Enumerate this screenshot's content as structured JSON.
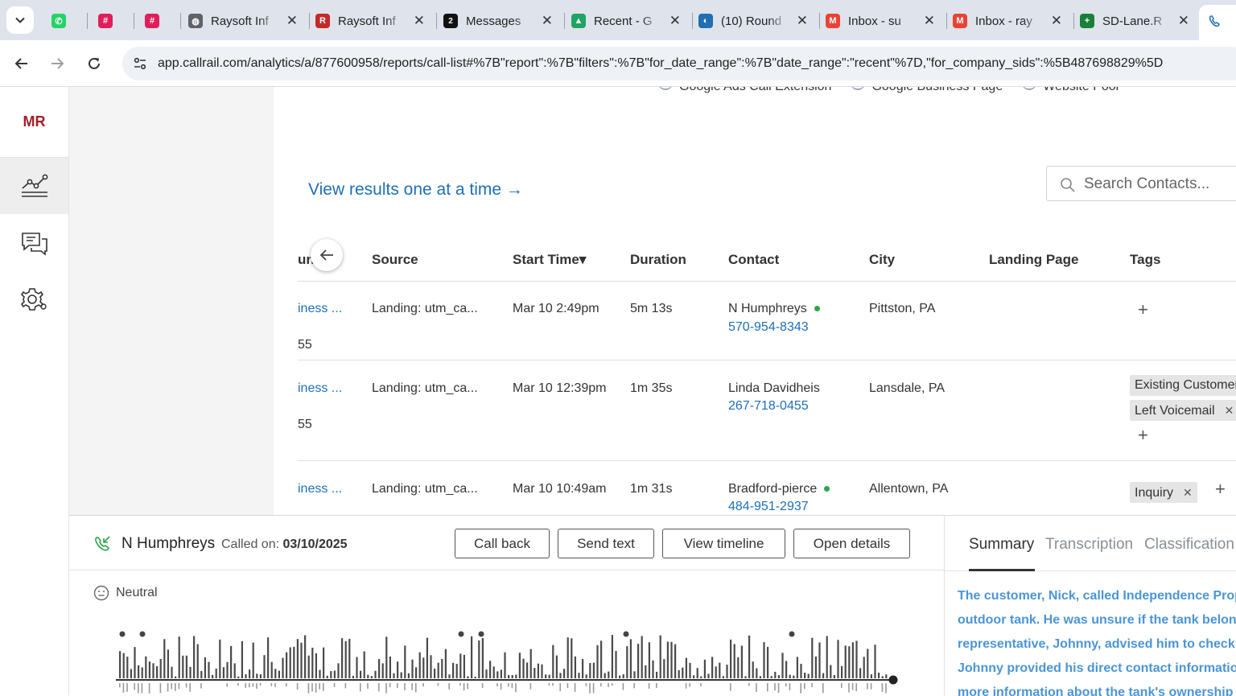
{
  "browser": {
    "tabs": [
      {
        "title": "",
        "icon": "whatsapp-icon",
        "color": "#25d366"
      },
      {
        "title": "",
        "icon": "slack-icon",
        "color": "#e01e5a"
      },
      {
        "title": "",
        "icon": "slack-icon",
        "color": "#e01e5a"
      },
      {
        "title": "Raysoft Inf",
        "icon": "globe-icon",
        "color": "#5f6368"
      },
      {
        "title": "Raysoft Inf",
        "icon": "raysoft-icon",
        "color": "#c62828"
      },
      {
        "title": "Messages",
        "icon": "messages-icon",
        "color": "#111111"
      },
      {
        "title": "Recent - G",
        "icon": "google-drive-icon",
        "color": "#1fa463"
      },
      {
        "title": "(10) Round",
        "icon": "roundcube-icon",
        "color": "#1f6fb2"
      },
      {
        "title": "Inbox - su",
        "icon": "gmail-icon",
        "color": "#ea4335"
      },
      {
        "title": "Inbox - ray",
        "icon": "gmail-icon",
        "color": "#ea4335"
      },
      {
        "title": "SD-Lane.R",
        "icon": "sheets-icon",
        "color": "#188038"
      }
    ],
    "messages_badge": "2",
    "url": "app.callrail.com/analytics/a/877600958/reports/call-list#%7B\"report\":%7B\"filters\":%7B\"for_date_range\":%7B\"date_range\":\"recent\"%7D,\"for_company_sids\":%5B487698829%5D"
  },
  "nav": {
    "initials": "MR",
    "items": [
      {
        "name": "analytics",
        "icon": "analytics-icon",
        "active": true
      },
      {
        "name": "messages",
        "icon": "chat-icon",
        "active": false
      },
      {
        "name": "settings",
        "icon": "gear-icon",
        "active": false
      }
    ]
  },
  "legend": [
    "Google Ads Call Extension",
    "Google Business Page",
    "Website Pool"
  ],
  "view_results": "View results one at a time →",
  "search": {
    "placeholder": "Search Contacts..."
  },
  "table": {
    "columns": [
      "un",
      "Source",
      "Start Time▾",
      "Duration",
      "Contact",
      "City",
      "Landing Page",
      "Tags"
    ],
    "rows": [
      {
        "tracking": "iness ...",
        "tracking_num": "55",
        "source": "Landing: utm_ca...",
        "start": "Mar 10 2:49pm",
        "duration": "5m 13s",
        "contact": "N Humphreys",
        "phone": "570-954-8343",
        "online": true,
        "city": "Pittston, PA",
        "landing": "",
        "tags": []
      },
      {
        "tracking": "iness ...",
        "tracking_num": "55",
        "source": "Landing: utm_ca...",
        "start": "Mar 10 12:39pm",
        "duration": "1m 35s",
        "contact": "Linda Davidheis",
        "phone": "267-718-0455",
        "online": false,
        "city": "Lansdale, PA",
        "landing": "",
        "tags": [
          "Existing Customer",
          "Left Voicemail"
        ]
      },
      {
        "tracking": "iness ...",
        "tracking_num": "",
        "source": "Landing: utm_ca...",
        "start": "Mar 10 10:49am",
        "duration": "1m 31s",
        "contact": "Bradford-pierce",
        "phone": "484-951-2937",
        "online": true,
        "city": "Allentown, PA",
        "landing": "",
        "tags": [
          "Inquiry"
        ]
      }
    ]
  },
  "call_panel": {
    "name": "N Humphreys",
    "called_on_label": "Called on:",
    "called_on_date": "03/10/2025",
    "buttons": [
      "Call back",
      "Send text",
      "View timeline",
      "Open details"
    ],
    "sentiment": "Neutral",
    "tabs": [
      "Summary",
      "Transcription",
      "Classification"
    ],
    "summary_lines": [
      "The customer, Nick, called Independence Prop",
      "outdoor tank. He was unsure if the tank belong",
      "representative, Johnny, advised him to check f",
      "Johnny provided his direct contact informatio",
      "more information about the tank's ownership"
    ]
  },
  "colors": {
    "accent": "#1d6fb8",
    "brand": "#a1202c",
    "online": "#29a847",
    "summary": "#4a95d6"
  }
}
